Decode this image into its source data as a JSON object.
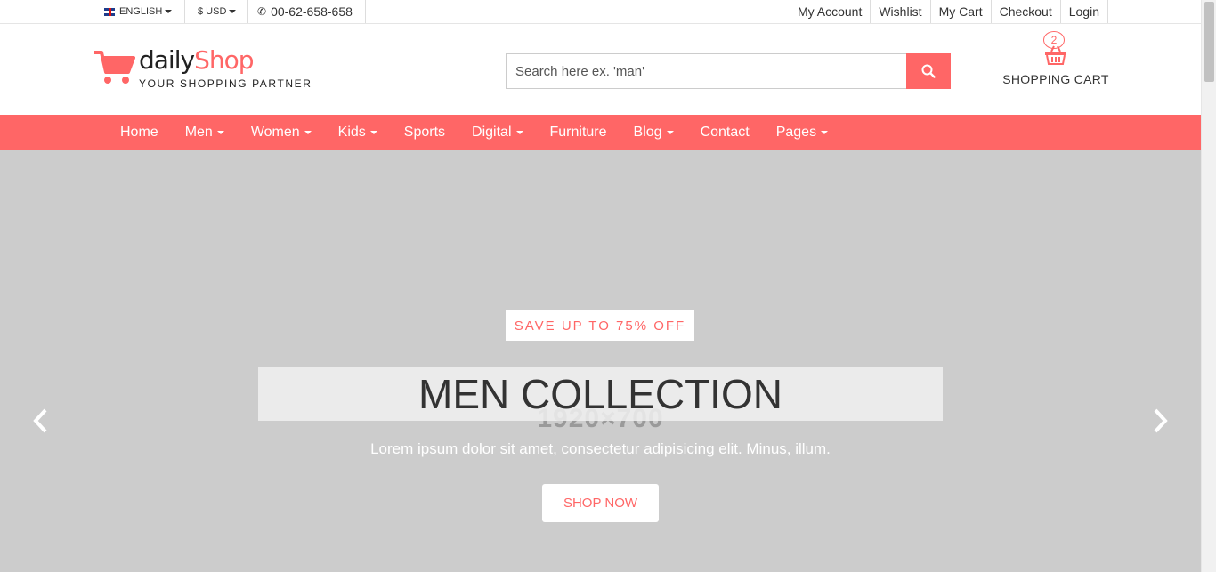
{
  "topbar": {
    "language": "ENGLISH",
    "currency": "$ USD",
    "phone": "00-62-658-658",
    "links": [
      "My Account",
      "Wishlist",
      "My Cart",
      "Checkout",
      "Login"
    ]
  },
  "header": {
    "logo_part1": "daily",
    "logo_part2": "Shop",
    "tagline": "YOUR SHOPPING PARTNER",
    "search_placeholder": "Search here ex. 'man'",
    "cart_count": "2",
    "cart_label": "SHOPPING CART"
  },
  "nav": {
    "items": [
      {
        "label": "Home",
        "dropdown": false
      },
      {
        "label": "Men",
        "dropdown": true
      },
      {
        "label": "Women",
        "dropdown": true
      },
      {
        "label": "Kids",
        "dropdown": true
      },
      {
        "label": "Sports",
        "dropdown": false
      },
      {
        "label": "Digital",
        "dropdown": true
      },
      {
        "label": "Furniture",
        "dropdown": false
      },
      {
        "label": "Blog",
        "dropdown": true
      },
      {
        "label": "Contact",
        "dropdown": false
      },
      {
        "label": "Pages",
        "dropdown": true
      }
    ]
  },
  "slider": {
    "placeholder_size": "1920×700",
    "promo": "SAVE UP TO 75% OFF",
    "headline": "MEN COLLECTION",
    "subtext": "Lorem ipsum dolor sit amet, consectetur adipisicing elit. Minus, illum.",
    "cta": "SHOP NOW"
  },
  "colors": {
    "accent": "#ff6666",
    "slider_bg": "#cccccc"
  }
}
